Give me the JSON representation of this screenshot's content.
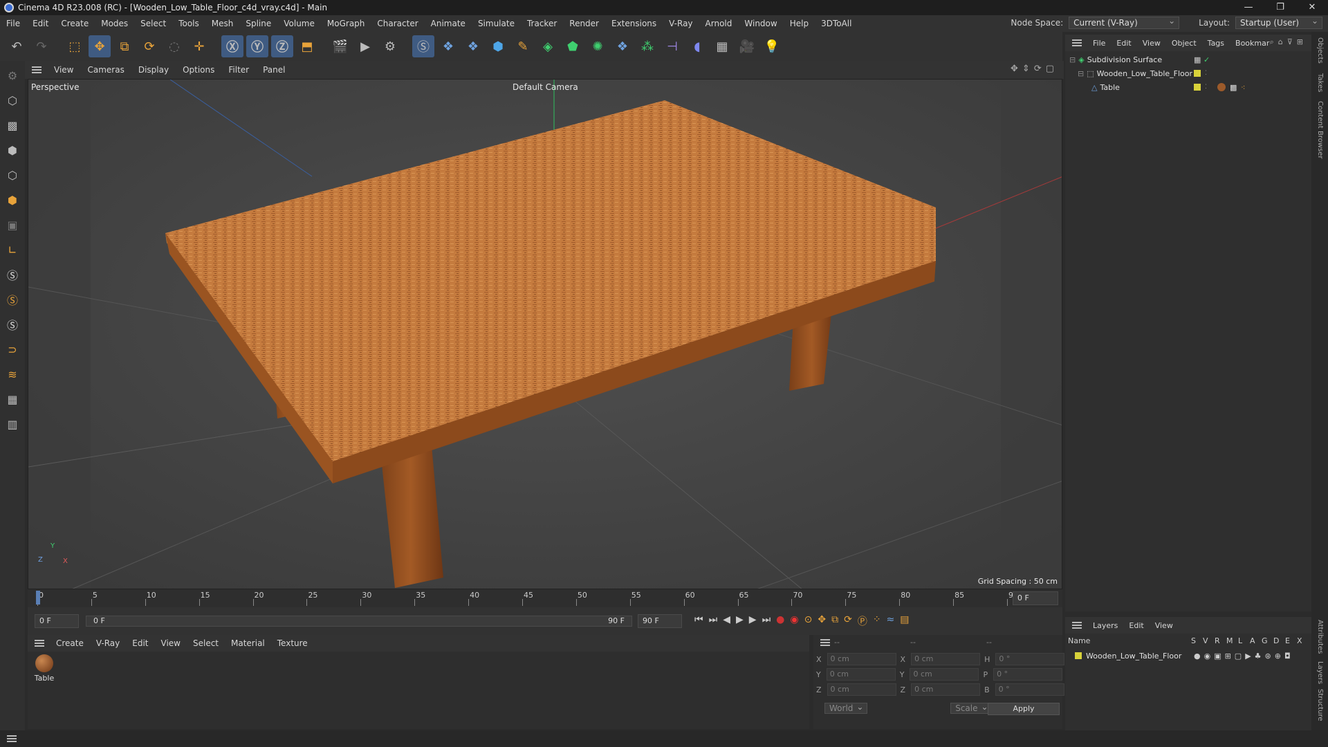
{
  "window": {
    "title": "Cinema 4D R23.008 (RC) - [Wooden_Low_Table_Floor_c4d_vray.c4d] - Main",
    "controls": [
      "—",
      "❐",
      "✕"
    ]
  },
  "menubar": {
    "items": [
      "File",
      "Edit",
      "Create",
      "Modes",
      "Select",
      "Tools",
      "Mesh",
      "Spline",
      "Volume",
      "MoGraph",
      "Character",
      "Animate",
      "Simulate",
      "Tracker",
      "Render",
      "Extensions",
      "V-Ray",
      "Arnold",
      "Window",
      "Help",
      "3DToAll"
    ],
    "node_space_label": "Node Space:",
    "node_space_value": "Current (V-Ray)",
    "layout_label": "Layout:",
    "layout_value": "Startup (User)"
  },
  "viewport_menu": {
    "items": [
      "View",
      "Cameras",
      "Display",
      "Options",
      "Filter",
      "Panel"
    ]
  },
  "viewport": {
    "name": "Perspective",
    "camera": "Default Camera",
    "grid_spacing": "Grid Spacing : 50 cm",
    "axis_labels": [
      "Y",
      "Z",
      "X"
    ]
  },
  "timeline": {
    "ticks": [
      "0",
      "5",
      "10",
      "15",
      "20",
      "25",
      "30",
      "35",
      "40",
      "45",
      "50",
      "55",
      "60",
      "65",
      "70",
      "75",
      "80",
      "85",
      "90"
    ],
    "current_frame_right": "0 F",
    "start_field": "0 F",
    "range_start": "0 F",
    "range_end": "90 F",
    "end_field": "90 F"
  },
  "material_menu": {
    "items": [
      "Create",
      "V-Ray",
      "Edit",
      "View",
      "Select",
      "Material",
      "Texture"
    ]
  },
  "materials": [
    {
      "name": "Table"
    }
  ],
  "coordinates": {
    "header": [
      "--",
      "--",
      "--"
    ],
    "rows": [
      {
        "a_label": "X",
        "a_value": "0 cm",
        "b_label": "X",
        "b_value": "0 cm",
        "c_label": "H",
        "c_value": "0 °"
      },
      {
        "a_label": "Y",
        "a_value": "0 cm",
        "b_label": "Y",
        "b_value": "0 cm",
        "c_label": "P",
        "c_value": "0 °"
      },
      {
        "a_label": "Z",
        "a_value": "0 cm",
        "b_label": "Z",
        "b_value": "0 cm",
        "c_label": "B",
        "c_value": "0 °"
      }
    ],
    "mode": "World",
    "transform": "Scale",
    "apply": "Apply"
  },
  "object_manager": {
    "menu": [
      "File",
      "Edit",
      "View",
      "Object",
      "Tags",
      "Bookmar"
    ],
    "objects": [
      {
        "name": "Subdivision Surface",
        "indent": 0
      },
      {
        "name": "Wooden_Low_Table_Floor",
        "indent": 1
      },
      {
        "name": "Table",
        "indent": 2
      }
    ]
  },
  "layers_manager": {
    "menu": [
      "Layers",
      "Edit",
      "View"
    ],
    "columns": [
      "Name",
      "S",
      "V",
      "R",
      "M",
      "L",
      "A",
      "G",
      "D",
      "E",
      "X"
    ],
    "layers": [
      {
        "name": "Wooden_Low_Table_Floor",
        "color": "#d8d23a"
      }
    ]
  },
  "right_tabs": [
    "Objects",
    "Takes",
    "Content Browser",
    "Attributes",
    "Layers",
    "Structure"
  ],
  "colors": {
    "accent_blue": "#3f5b82",
    "layer_yellow": "#d8d23a",
    "wood": "#b86a2c"
  }
}
